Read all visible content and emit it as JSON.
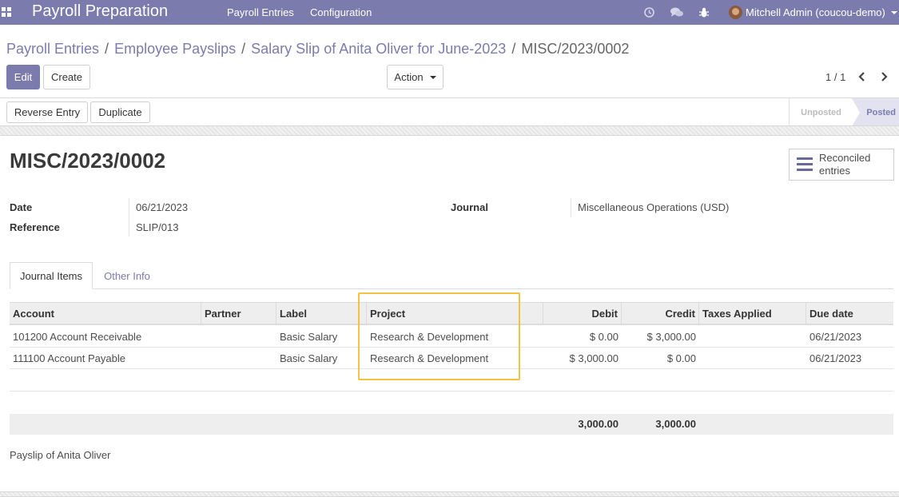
{
  "navbar": {
    "app_title": "Payroll Preparation",
    "menus": [
      "Payroll Entries",
      "Configuration"
    ],
    "user_name": "Mitchell Admin (coucou-demo)",
    "accent_color": "#7c7bad"
  },
  "breadcrumb": {
    "items": [
      "Payroll Entries",
      "Employee Payslips",
      "Salary Slip of Anita Oliver for June-2023"
    ],
    "current": "MISC/2023/0002"
  },
  "toolbar": {
    "edit_label": "Edit",
    "create_label": "Create",
    "action_label": "Action",
    "pager_value": "1 / 1"
  },
  "statusbar": {
    "reverse_label": "Reverse Entry",
    "duplicate_label": "Duplicate",
    "stages": [
      "Unposted",
      "Posted"
    ],
    "current_stage": "Posted"
  },
  "record": {
    "title": "MISC/2023/0002",
    "smart_button_label": "Reconciled entries",
    "fields": {
      "date_label": "Date",
      "date_value": "06/21/2023",
      "reference_label": "Reference",
      "reference_value": "SLIP/013",
      "journal_label": "Journal",
      "journal_value": "Miscellaneous Operations (USD)"
    }
  },
  "notebook": {
    "tabs": [
      "Journal Items",
      "Other Info"
    ],
    "active_tab": "Journal Items"
  },
  "journal_items": {
    "columns": [
      "Account",
      "Partner",
      "Label",
      "Project",
      "Debit",
      "Credit",
      "Taxes Applied",
      "Due date"
    ],
    "rows": [
      {
        "account": "101200 Account Receivable",
        "partner": "",
        "label": "Basic Salary",
        "project": "Research & Development",
        "debit": "$ 0.00",
        "credit": "$ 3,000.00",
        "taxes": "",
        "due_date": "06/21/2023"
      },
      {
        "account": "111100 Account Payable",
        "partner": "",
        "label": "Basic Salary",
        "project": "Research & Development",
        "debit": "$ 3,000.00",
        "credit": "$ 0.00",
        "taxes": "",
        "due_date": "06/21/2023"
      }
    ],
    "totals": {
      "debit": "3,000.00",
      "credit": "3,000.00"
    },
    "highlight_color": "#f5c242"
  },
  "narration": "Payslip of Anita Oliver"
}
